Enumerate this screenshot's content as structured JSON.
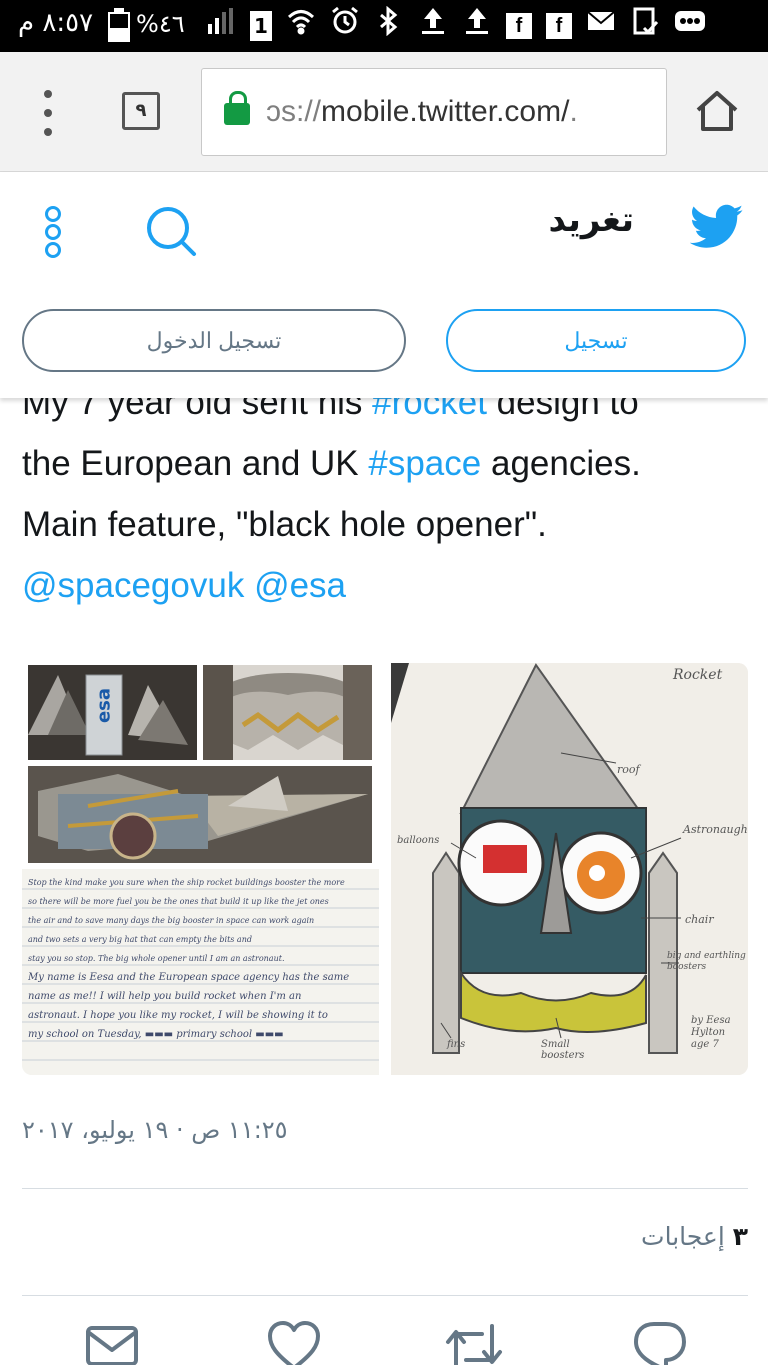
{
  "status_bar": {
    "time": "٨:٥٧ م",
    "battery_percent": "%٤٦",
    "battery_level": 0.46,
    "sim_number": "1",
    "icons": [
      "signal-icon",
      "sim-icon",
      "wifi-icon",
      "alarm-icon",
      "bluetooth-icon",
      "upload-icon",
      "upload-icon",
      "facebook-icon",
      "facebook-icon",
      "mail-icon",
      "clipboard-check-icon",
      "more-icon"
    ]
  },
  "browser": {
    "url_prefix": "ɔs://",
    "url_host": "mobile.twitter.com/",
    "url_tail": "‏.",
    "tab_count": "٩"
  },
  "header": {
    "title": "تغريد",
    "login_label": "تسجيل الدخول",
    "signup_label": "تسجيل"
  },
  "tweet": {
    "line1_a": "My 7 year old sent his ",
    "line1_link": "#rocket",
    "line1_b": " design to",
    "line2_a": "the European and UK ",
    "line2_link": "#space",
    "line2_b": " agencies.",
    "line3": "Main feature, \"black hole opener\".",
    "mention1": "@spacegovuk",
    "mention2": "@esa",
    "esa_label": "esa",
    "drawing_title": "Rocket",
    "drawing_labels": {
      "roof": "roof",
      "astronaut": "Astronaught",
      "balloons": "balloons",
      "chair": "chair",
      "boosters": "big and earthling boosters",
      "small_boosters": "Small boosters",
      "fins": "fins",
      "signature": "by Eesa Hylton age 7"
    },
    "letter_lines": [
      "Stop the kind make you sure when the ship rocket buildings booster the more",
      "so there will be more fuel you be the ones that build it up like the jet ones",
      "the air and to save many days the big booster in space can work again",
      "and two sets a very big hat that can empty the bits and",
      "stay you so stop. The big whole opener until I am an astronaut.",
      "My name is Eesa and the European space agency has the same",
      "name as me!! I will help you build rocket when I'm an",
      "astronaut. I hope you like my rocket, I will be showing it to",
      "my school on Tuesday, ▬▬▬ primary school ▬▬▬"
    ],
    "date": "١١:٢٥ ص · ١٩ يوليو، ٢٠١٧",
    "likes_count": "٣",
    "likes_label": "إعجابات"
  },
  "colors": {
    "brand": "#1da1f2",
    "text": "#14171a",
    "muted": "#657786",
    "secure": "#139a43"
  }
}
